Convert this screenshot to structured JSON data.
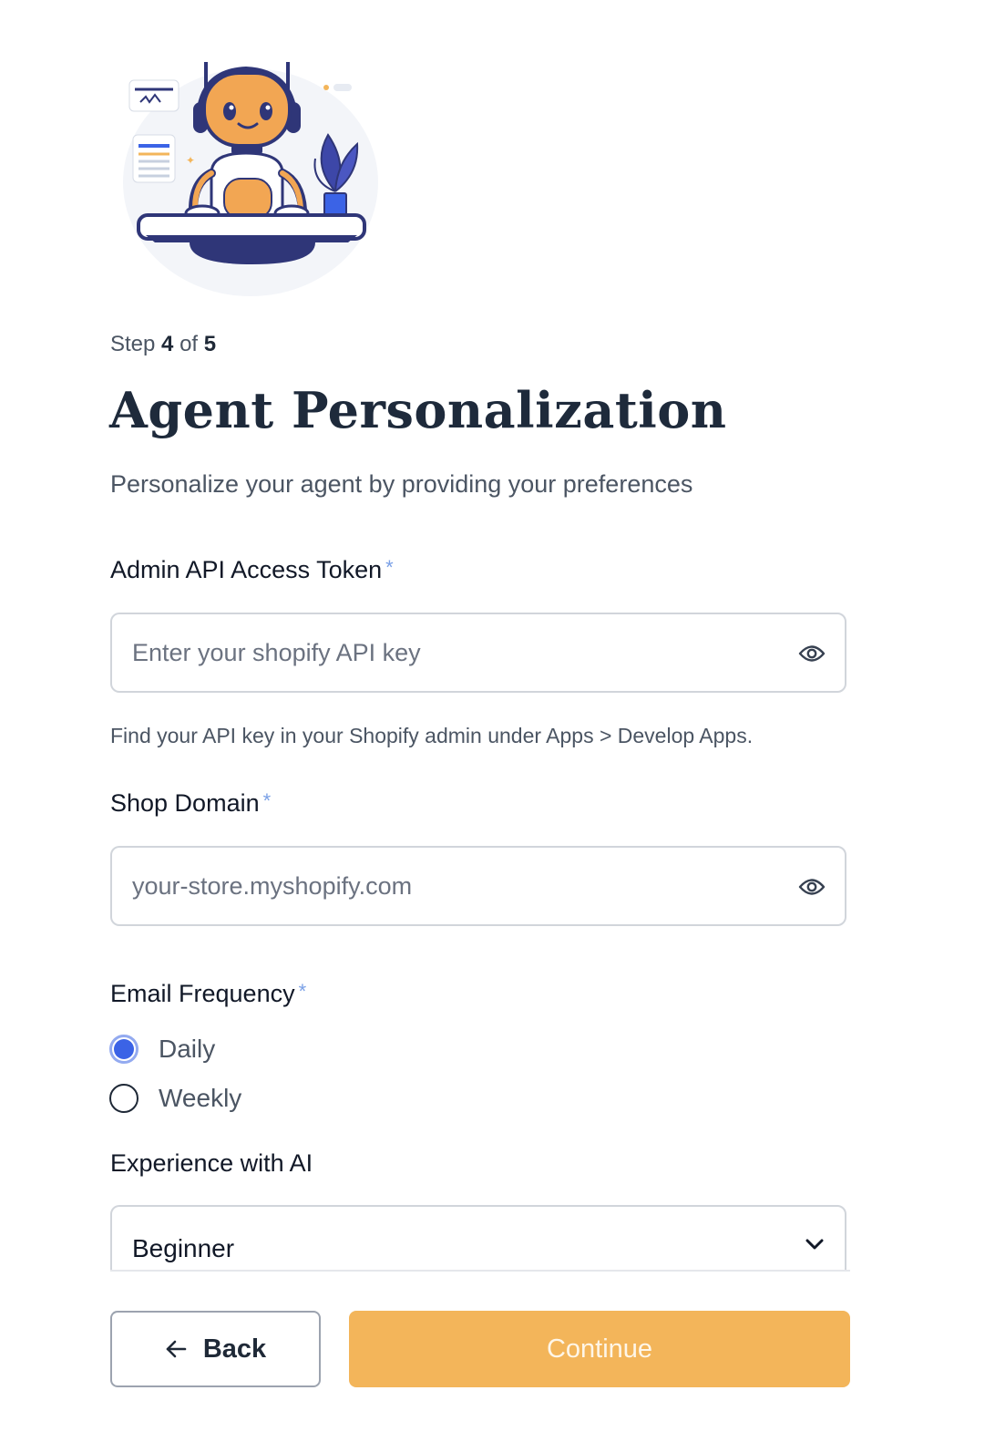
{
  "step": {
    "prefix": "Step",
    "current": "4",
    "separator": "of",
    "total": "5"
  },
  "header": {
    "title": "Agent Personalization",
    "subtitle": "Personalize your agent by providing your preferences"
  },
  "form": {
    "required_mark": "*",
    "api_token": {
      "label": "Admin API Access Token",
      "value": "",
      "placeholder": "Enter your shopify API key",
      "helper": "Find your API key in your Shopify admin under Apps > Develop Apps."
    },
    "shop_domain": {
      "label": "Shop Domain",
      "value": "",
      "placeholder": "your-store.myshopify.com"
    },
    "email_frequency": {
      "label": "Email Frequency",
      "options": [
        {
          "label": "Daily",
          "selected": true
        },
        {
          "label": "Weekly",
          "selected": false
        }
      ]
    },
    "ai_experience": {
      "label": "Experience with AI",
      "selected": "Beginner"
    }
  },
  "footer": {
    "back_label": "Back",
    "continue_label": "Continue"
  },
  "icons": {
    "illustration": "robot-at-desk-illustration",
    "eye": "eye-icon",
    "chevron": "chevron-down-icon",
    "back_arrow": "arrow-left-icon"
  },
  "colors": {
    "accent": "#f3b55a",
    "radio_selected": "#3b63e6",
    "required_mark": "#7aa0e6",
    "title": "#1e2a3b"
  }
}
